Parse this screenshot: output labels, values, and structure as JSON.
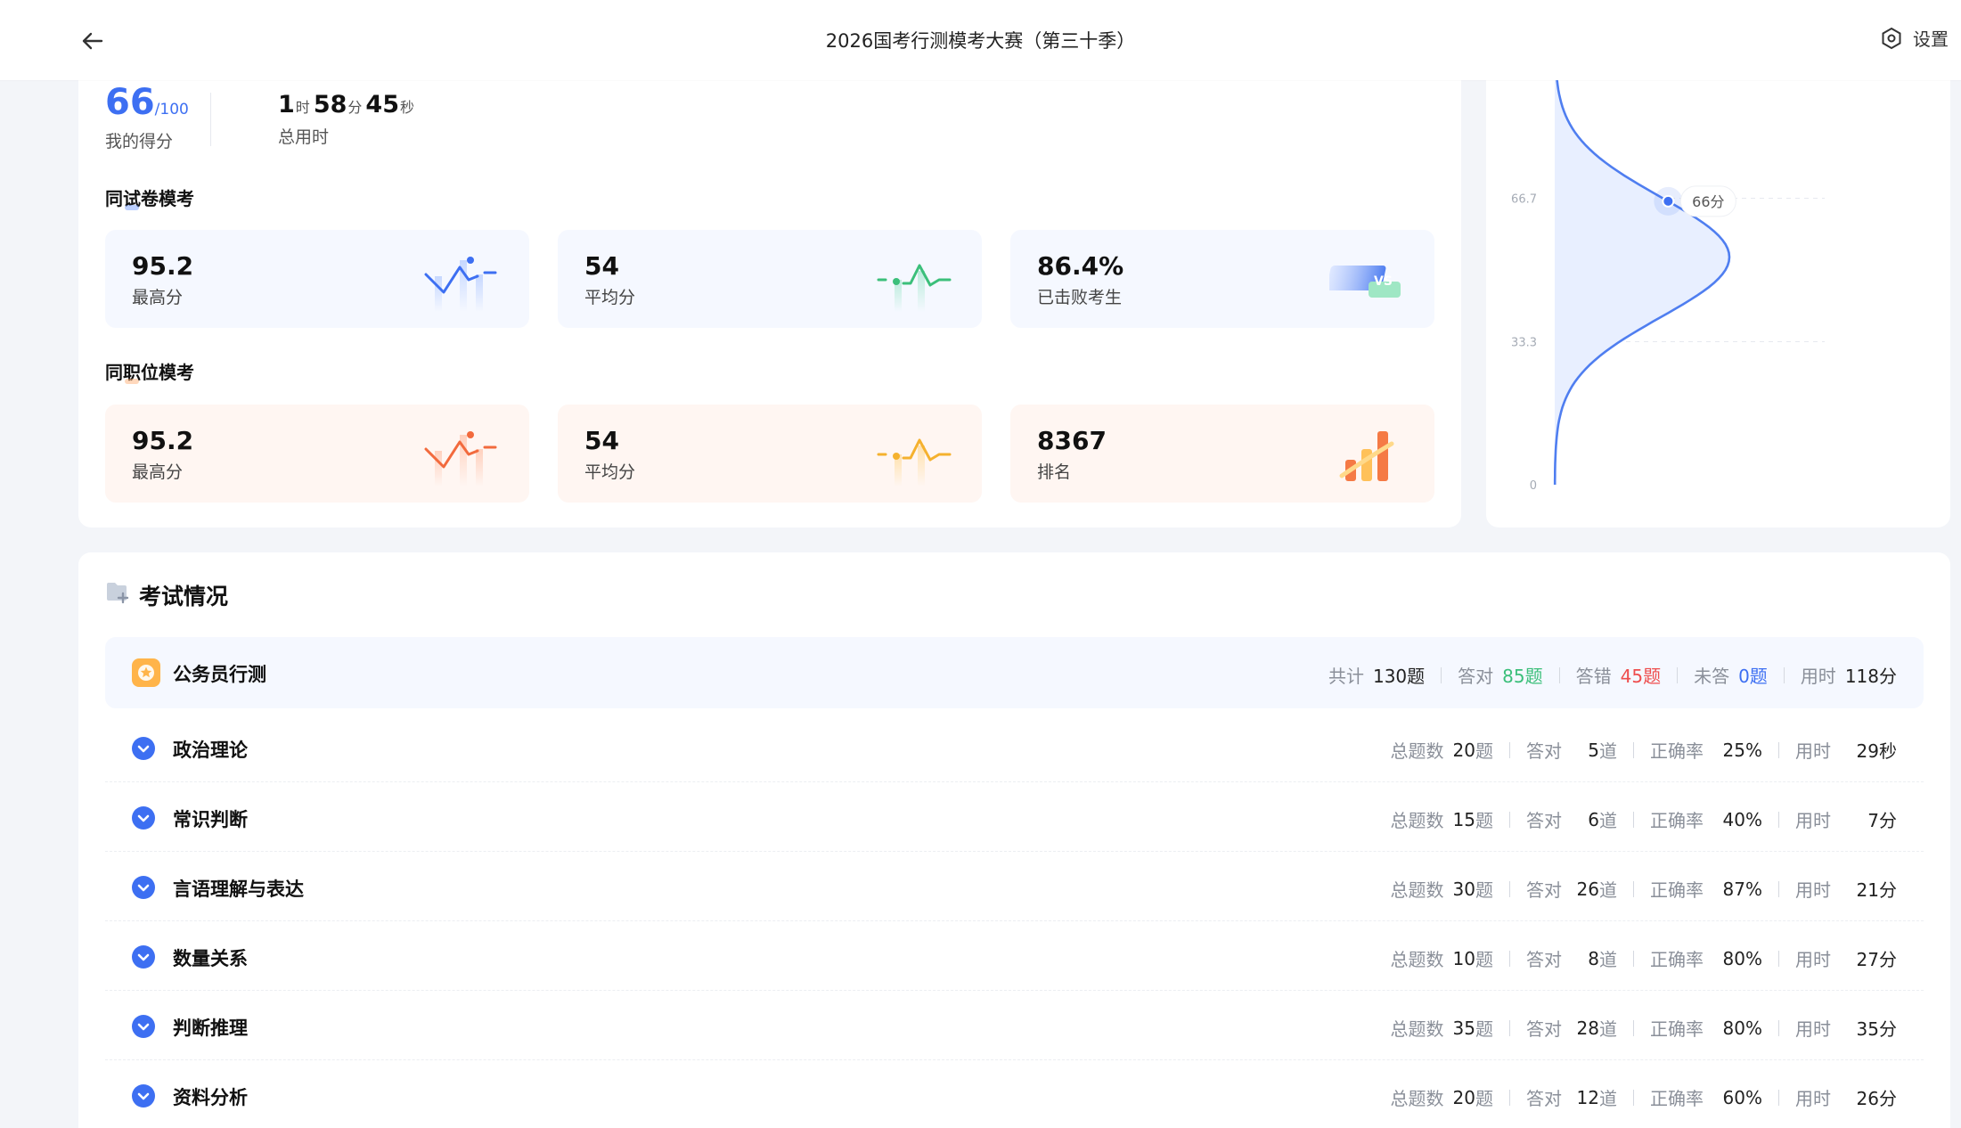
{
  "header": {
    "title": "2026国考行测模考大赛（第三十季）",
    "settings_label": "设置"
  },
  "summary": {
    "score": "66",
    "score_total": "/100",
    "score_label": "我的得分",
    "time_h": "1",
    "time_h_unit": "时",
    "time_m": "58",
    "time_m_unit": "分",
    "time_s": "45",
    "time_s_unit": "秒",
    "time_label": "总用时"
  },
  "same_paper": {
    "title": "同试卷模考",
    "cards": [
      {
        "value": "95.2",
        "label": "最高分",
        "icon": "peak-chart-icon"
      },
      {
        "value": "54",
        "label": "平均分",
        "icon": "average-chart-icon"
      },
      {
        "value": "86.4%",
        "label": "已击败考生",
        "icon": "vs-icon"
      }
    ]
  },
  "same_position": {
    "title": "同职位模考",
    "cards": [
      {
        "value": "95.2",
        "label": "最高分",
        "icon": "peak-chart-icon"
      },
      {
        "value": "54",
        "label": "平均分",
        "icon": "average-chart-icon"
      },
      {
        "value": "8367",
        "label": "排名",
        "icon": "ranking-bars-icon"
      }
    ]
  },
  "chart_data": {
    "type": "area",
    "title": "",
    "xlabel": "",
    "ylabel": "",
    "y_ticks": [
      "0",
      "33.3",
      "66.7"
    ],
    "ylim": [
      0,
      100
    ],
    "marker": {
      "y": 66,
      "label": "66分"
    },
    "grid": true,
    "colors": {
      "line": "#4f7ef0",
      "fill": "#e8efff",
      "marker": "#3d6ff2"
    }
  },
  "exam": {
    "title": "考试情况",
    "subject": {
      "name": "公务员行测",
      "total_label": "共计",
      "total_value": "130题",
      "correct_label": "答对",
      "correct_value": "85题",
      "wrong_label": "答错",
      "wrong_value": "45题",
      "unanswered_label": "未答",
      "unanswered_value": "0题",
      "time_label": "用时",
      "time_value": "118分"
    },
    "col_labels": {
      "total": "总题数",
      "correct": "答对",
      "accuracy": "正确率",
      "time": "用时"
    },
    "modules": [
      {
        "name": "政治理论",
        "total_num": "20",
        "correct_num": "5",
        "unit": "题",
        "correct_unit": "道",
        "accuracy": "25%",
        "time": "29秒"
      },
      {
        "name": "常识判断",
        "total_num": "15",
        "correct_num": "6",
        "unit": "题",
        "correct_unit": "道",
        "accuracy": "40%",
        "time": "7分"
      },
      {
        "name": "言语理解与表达",
        "total_num": "30",
        "correct_num": "26",
        "unit": "题",
        "correct_unit": "道",
        "accuracy": "87%",
        "time": "21分"
      },
      {
        "name": "数量关系",
        "total_num": "10",
        "correct_num": "8",
        "unit": "题",
        "correct_unit": "道",
        "accuracy": "80%",
        "time": "27分"
      },
      {
        "name": "判断推理",
        "total_num": "35",
        "correct_num": "28",
        "unit": "题",
        "correct_unit": "道",
        "accuracy": "80%",
        "time": "35分"
      },
      {
        "name": "资料分析",
        "total_num": "20",
        "correct_num": "12",
        "unit": "题",
        "correct_unit": "道",
        "accuracy": "60%",
        "time": "26分"
      }
    ]
  }
}
